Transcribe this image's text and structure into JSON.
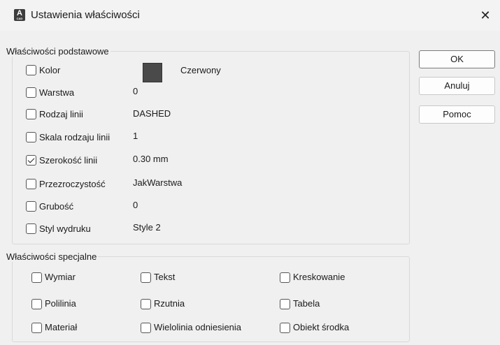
{
  "window": {
    "title": "Ustawienia właściwości",
    "close_label": "✕",
    "icon_letter": "A",
    "icon_sub": "CAD"
  },
  "basic": {
    "legend": "Właściwości podstawowe",
    "rows": [
      {
        "label": "Kolor",
        "checked": false,
        "value": "Czerwony",
        "swatch": "#4a4a4a"
      },
      {
        "label": "Warstwa",
        "checked": false,
        "value": "0"
      },
      {
        "label": "Rodzaj linii",
        "checked": false,
        "value": "DASHED"
      },
      {
        "label": "Skala rodzaju linii",
        "checked": false,
        "value": "1"
      },
      {
        "label": "Szerokość linii",
        "checked": true,
        "value": "0.30 mm"
      },
      {
        "label": "Przezroczystość",
        "checked": false,
        "value": "JakWarstwa"
      },
      {
        "label": "Grubość",
        "checked": false,
        "value": "0"
      },
      {
        "label": "Styl wydruku",
        "checked": false,
        "value": "Style 2"
      }
    ]
  },
  "special": {
    "legend": "Właściwości specjalne",
    "items": [
      {
        "label": "Wymiar",
        "checked": false
      },
      {
        "label": "Tekst",
        "checked": false
      },
      {
        "label": "Kreskowanie",
        "checked": false
      },
      {
        "label": "Polilinia",
        "checked": false
      },
      {
        "label": "Rzutnia",
        "checked": false
      },
      {
        "label": "Tabela",
        "checked": false
      },
      {
        "label": "Materiał",
        "checked": false
      },
      {
        "label": "Wielolinia odniesienia",
        "checked": false
      },
      {
        "label": "Obiekt środka",
        "checked": false
      }
    ]
  },
  "buttons": {
    "ok": "OK",
    "cancel": "Anuluj",
    "help": "Pomoc"
  }
}
